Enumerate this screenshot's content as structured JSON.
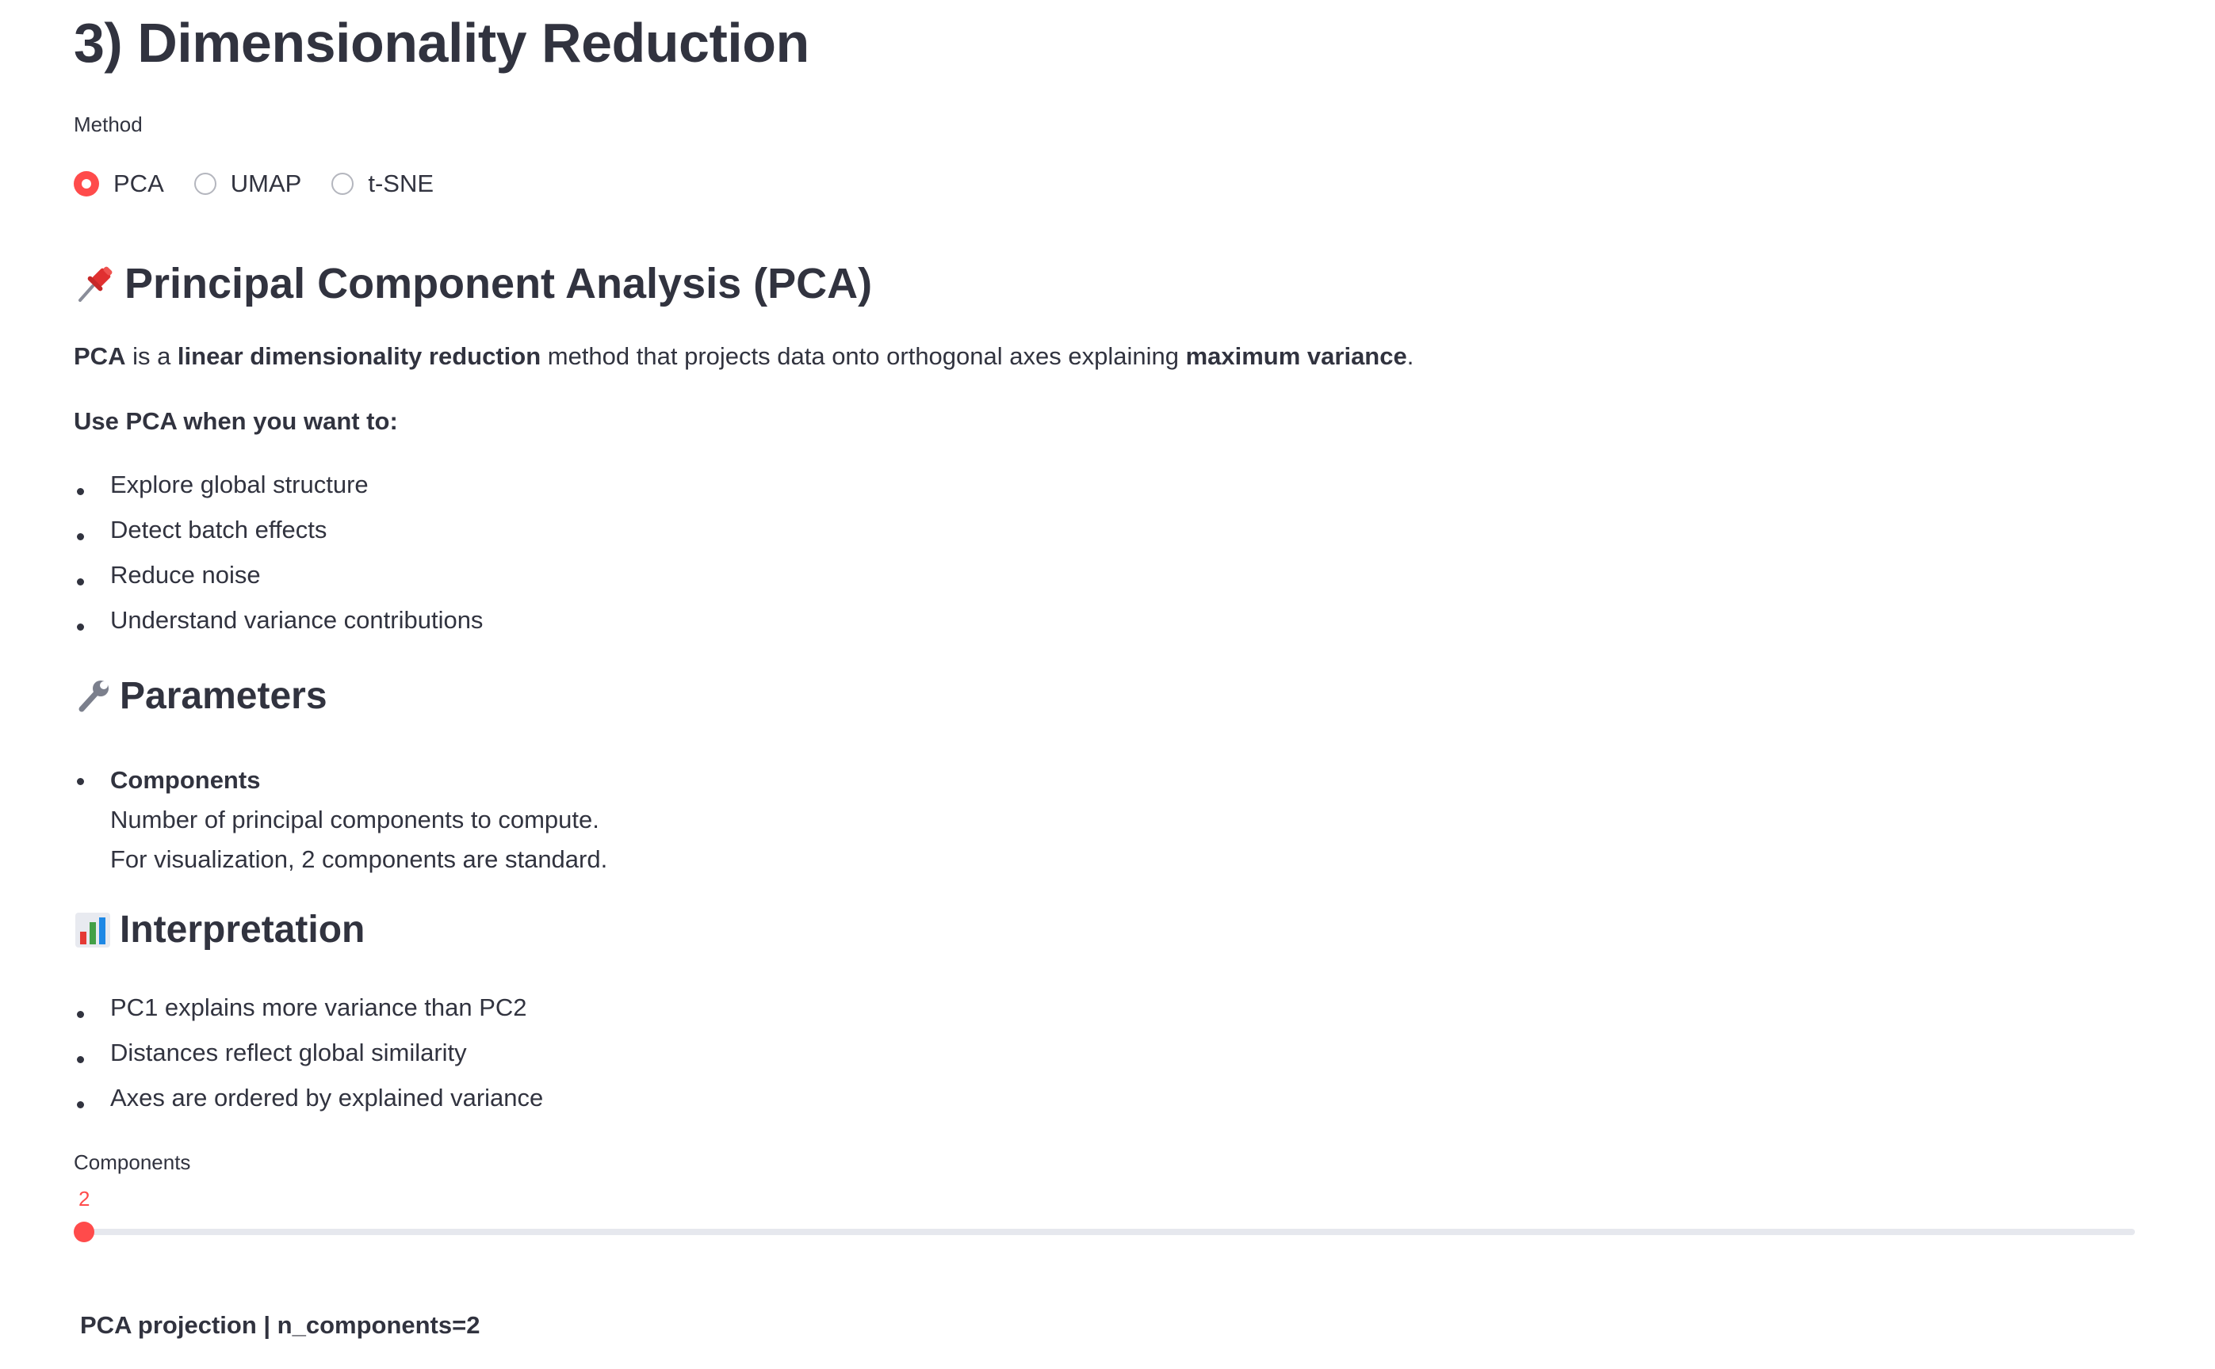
{
  "header": {
    "title": "3) Dimensionality Reduction"
  },
  "method": {
    "label": "Method",
    "options": [
      "PCA",
      "UMAP",
      "t-SNE"
    ],
    "selected": "PCA"
  },
  "pca_section": {
    "heading": "Principal Component Analysis (PCA)",
    "heading_icon": "pushpin-icon",
    "intro": {
      "part1": "PCA",
      "part2": " is a ",
      "part3": "linear dimensionality reduction",
      "part4": " method that projects data onto orthogonal axes explaining ",
      "part5": "maximum variance",
      "part6": "."
    },
    "use_when": "Use PCA when you want to:",
    "use_items": [
      "Explore global structure",
      "Detect batch effects",
      "Reduce noise",
      "Understand variance contributions"
    ]
  },
  "parameters_section": {
    "heading": "Parameters",
    "heading_icon": "wrench-icon",
    "param_name": "Components",
    "param_desc1": "Number of principal components to compute.",
    "param_desc2": "For visualization, 2 components are standard."
  },
  "interpretation_section": {
    "heading": "Interpretation",
    "heading_icon": "bar-chart-icon",
    "items": [
      "PC1 explains more variance than PC2",
      "Distances reflect global similarity",
      "Axes are ordered by explained variance"
    ]
  },
  "components_slider": {
    "label": "Components",
    "value": "2"
  },
  "plot": {
    "title": "PCA projection | n_components=2"
  },
  "colors": {
    "accent": "#ff4b4b",
    "text": "#31333f",
    "track": "#e6e8ee"
  }
}
